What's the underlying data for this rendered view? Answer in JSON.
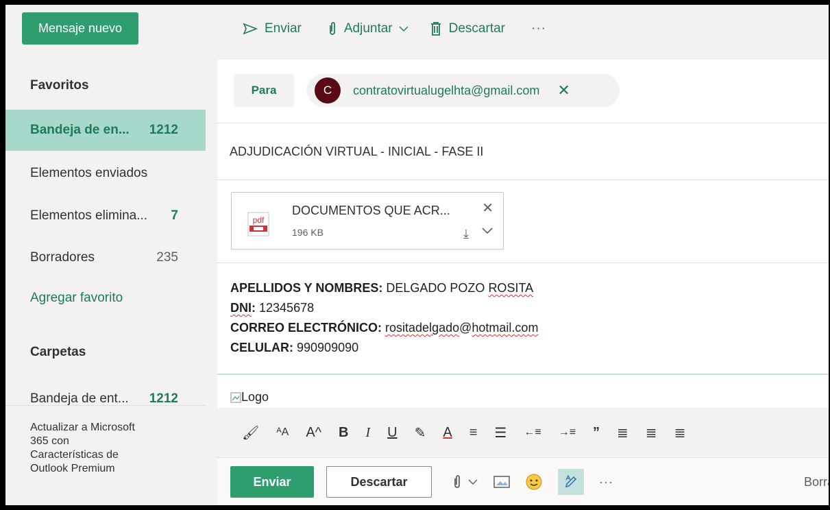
{
  "sidebar": {
    "new_message": "Mensaje nuevo",
    "favorites_header": "Favoritos",
    "items": [
      {
        "label": "Bandeja de en...",
        "count": "1212"
      },
      {
        "label": "Elementos enviados",
        "count": ""
      },
      {
        "label": "Elementos elimina...",
        "count": "7"
      },
      {
        "label": "Borradores",
        "count": "235"
      }
    ],
    "add_favorite": "Agregar favorito",
    "folders_header": "Carpetas",
    "folder_inbox": {
      "label": "Bandeja de ent...",
      "count": "1212"
    },
    "upgrade": {
      "line1": "Actualizar a Microsoft",
      "line2": "365 con",
      "line3": "Características de",
      "line4": "Outlook Premium"
    }
  },
  "toolbar": {
    "send": "Enviar",
    "attach": "Adjuntar",
    "discard": "Descartar",
    "more": "···"
  },
  "compose": {
    "to_label": "Para",
    "recipient_initial": "C",
    "recipient_email": "contratovirtualugelhta@gmail.com",
    "subject": "ADJUDICACIÓN VIRTUAL - INICIAL - FASE II",
    "attachment": {
      "name": "DOCUMENTOS QUE ACR...",
      "size": "196 KB",
      "icon_text": "pdf"
    },
    "body": {
      "name_label": "APELLIDOS Y NOMBRES:",
      "name_value_a": "DELGADO POZO",
      "name_value_b": "ROSITA",
      "dni_label": "DNI",
      "dni_colon": ":",
      "dni_value": "12345678",
      "email_label": "CORREO ELECTRÓNICO:",
      "email_user": "rositadelgado",
      "email_at": "@",
      "email_domain": "hotmail.com",
      "phone_label": "CELULAR:",
      "phone_value": "990909090"
    },
    "logo_alt": "Logo"
  },
  "format_bar": {
    "bold": "B",
    "italic": "I",
    "underline": "U",
    "font_color": "A",
    "quote": "”"
  },
  "actions": {
    "send": "Enviar",
    "discard": "Descartar",
    "more": "···",
    "draft": "Borra"
  },
  "colors": {
    "accent": "#2e9e6f",
    "accent_dark": "#1e7b5a",
    "selected_bg": "#a6d9cb",
    "avatar": "#5a0a14"
  }
}
